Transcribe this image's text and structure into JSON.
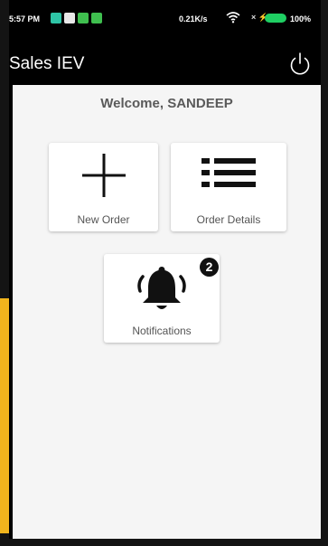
{
  "status_bar": {
    "time": "5:57 PM",
    "net_speed": "0.21K/s",
    "battery": "100%",
    "notification_icon_colors": [
      "#2ec4a6",
      "#e8e8e8",
      "#3fbf4f",
      "#3fbf4f"
    ],
    "battery_color": "#1fcf63"
  },
  "app_bar": {
    "title": "Sales IEV",
    "power_icon": "power-icon"
  },
  "main": {
    "welcome": "Welcome, SANDEEP",
    "tiles": [
      {
        "label": "New Order",
        "icon": "plus-icon"
      },
      {
        "label": "Order Details",
        "icon": "list-icon"
      },
      {
        "label": "Notifications",
        "icon": "bell-icon",
        "badge": "2"
      }
    ]
  },
  "colors": {
    "app_bar_bg": "#000000",
    "content_bg": "#f5f5f5",
    "accent_strip": "#f2b51d"
  }
}
